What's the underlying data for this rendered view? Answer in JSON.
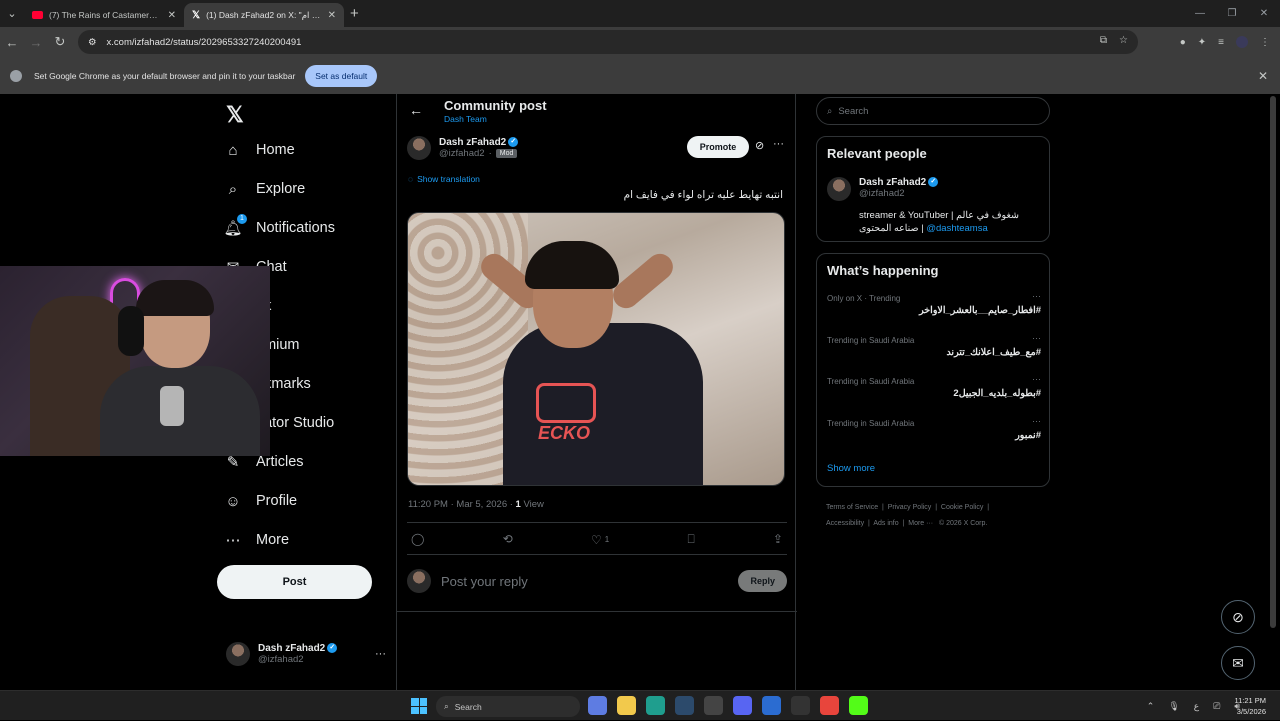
{
  "browser": {
    "tabs": [
      {
        "title": "(7) The Rains of Castamere (Re",
        "favicon": "youtube-icon"
      },
      {
        "title": "(1) Dash zFahad2 on X: \"شايف ام",
        "favicon": "x-icon"
      }
    ],
    "url": "x.com/izfahad2/status/2029653327240200491",
    "infobar_text": "Set Google Chrome as your default browser and pin it to your taskbar",
    "infobar_button": "Set as default"
  },
  "nav": {
    "items": [
      {
        "label": "Home",
        "icon": "home-icon"
      },
      {
        "label": "Explore",
        "icon": "search-icon"
      },
      {
        "label": "Notifications",
        "icon": "bell-icon",
        "badge": "1"
      },
      {
        "label": "Chat",
        "icon": "chat-icon"
      },
      {
        "label": "ok",
        "icon": "grok-icon"
      },
      {
        "label": "emium",
        "icon": "premium-icon"
      },
      {
        "label": "okmarks",
        "icon": "bookmark-icon"
      },
      {
        "label": "eator Studio",
        "icon": "studio-icon"
      },
      {
        "label": "Articles",
        "icon": "articles-icon"
      },
      {
        "label": "Profile",
        "icon": "profile-icon"
      },
      {
        "label": "More",
        "icon": "more-icon"
      }
    ],
    "post_label": "Post",
    "account": {
      "name": "Dash zFahad2",
      "handle": "@izfahad2"
    }
  },
  "post": {
    "header_title": "Community post",
    "community": "Dash Team",
    "author_name": "Dash zFahad2",
    "author_handle": "@izfahad2",
    "mod_badge": "Mod",
    "promote_label": "Promote",
    "show_translation": "Show translation",
    "text": "انتبه تهايط عليه تراه لواء في فايف ام",
    "timestamp": "11:20 PM · Mar 5, 2026 · ",
    "views_count": "1",
    "views_label": " View",
    "likes": "1",
    "reply_placeholder": "Post your reply",
    "reply_button": "Reply",
    "image_text": "ECKO"
  },
  "sidebar": {
    "search_placeholder": "Search",
    "relevant_title": "Relevant people",
    "person": {
      "name": "Dash zFahad2",
      "handle": "@izfahad2",
      "bio": "streamer & YouTuber | شغوف في عالم صناعه المحتوى | ",
      "bio_link": "@dashteamsa"
    },
    "happening_title": "What’s happening",
    "trends": [
      {
        "meta": "Only on X · Trending",
        "name": "#افطار_صايم__بالعشر_الاواخر"
      },
      {
        "meta": "Trending in Saudi Arabia",
        "name": "#مع_طيف_اعلانك_تترند"
      },
      {
        "meta": "Trending in Saudi Arabia",
        "name": "#بطوله_بلديه_الجبيل2"
      },
      {
        "meta": "Trending in Saudi Arabia",
        "name": "#نمبور"
      }
    ],
    "show_more": "Show more",
    "footer": [
      "Terms of Service",
      "Privacy Policy",
      "Cookie Policy",
      "Accessibility",
      "Ads info",
      "More ···",
      "© 2026 X Corp."
    ]
  },
  "taskbar": {
    "search_label": "Search",
    "time": "11:21 PM",
    "date": "3/5/2026",
    "lang": "ع"
  },
  "colors": {
    "accent": "#1d9bf0",
    "background": "#000000",
    "border": "#2f3336"
  }
}
